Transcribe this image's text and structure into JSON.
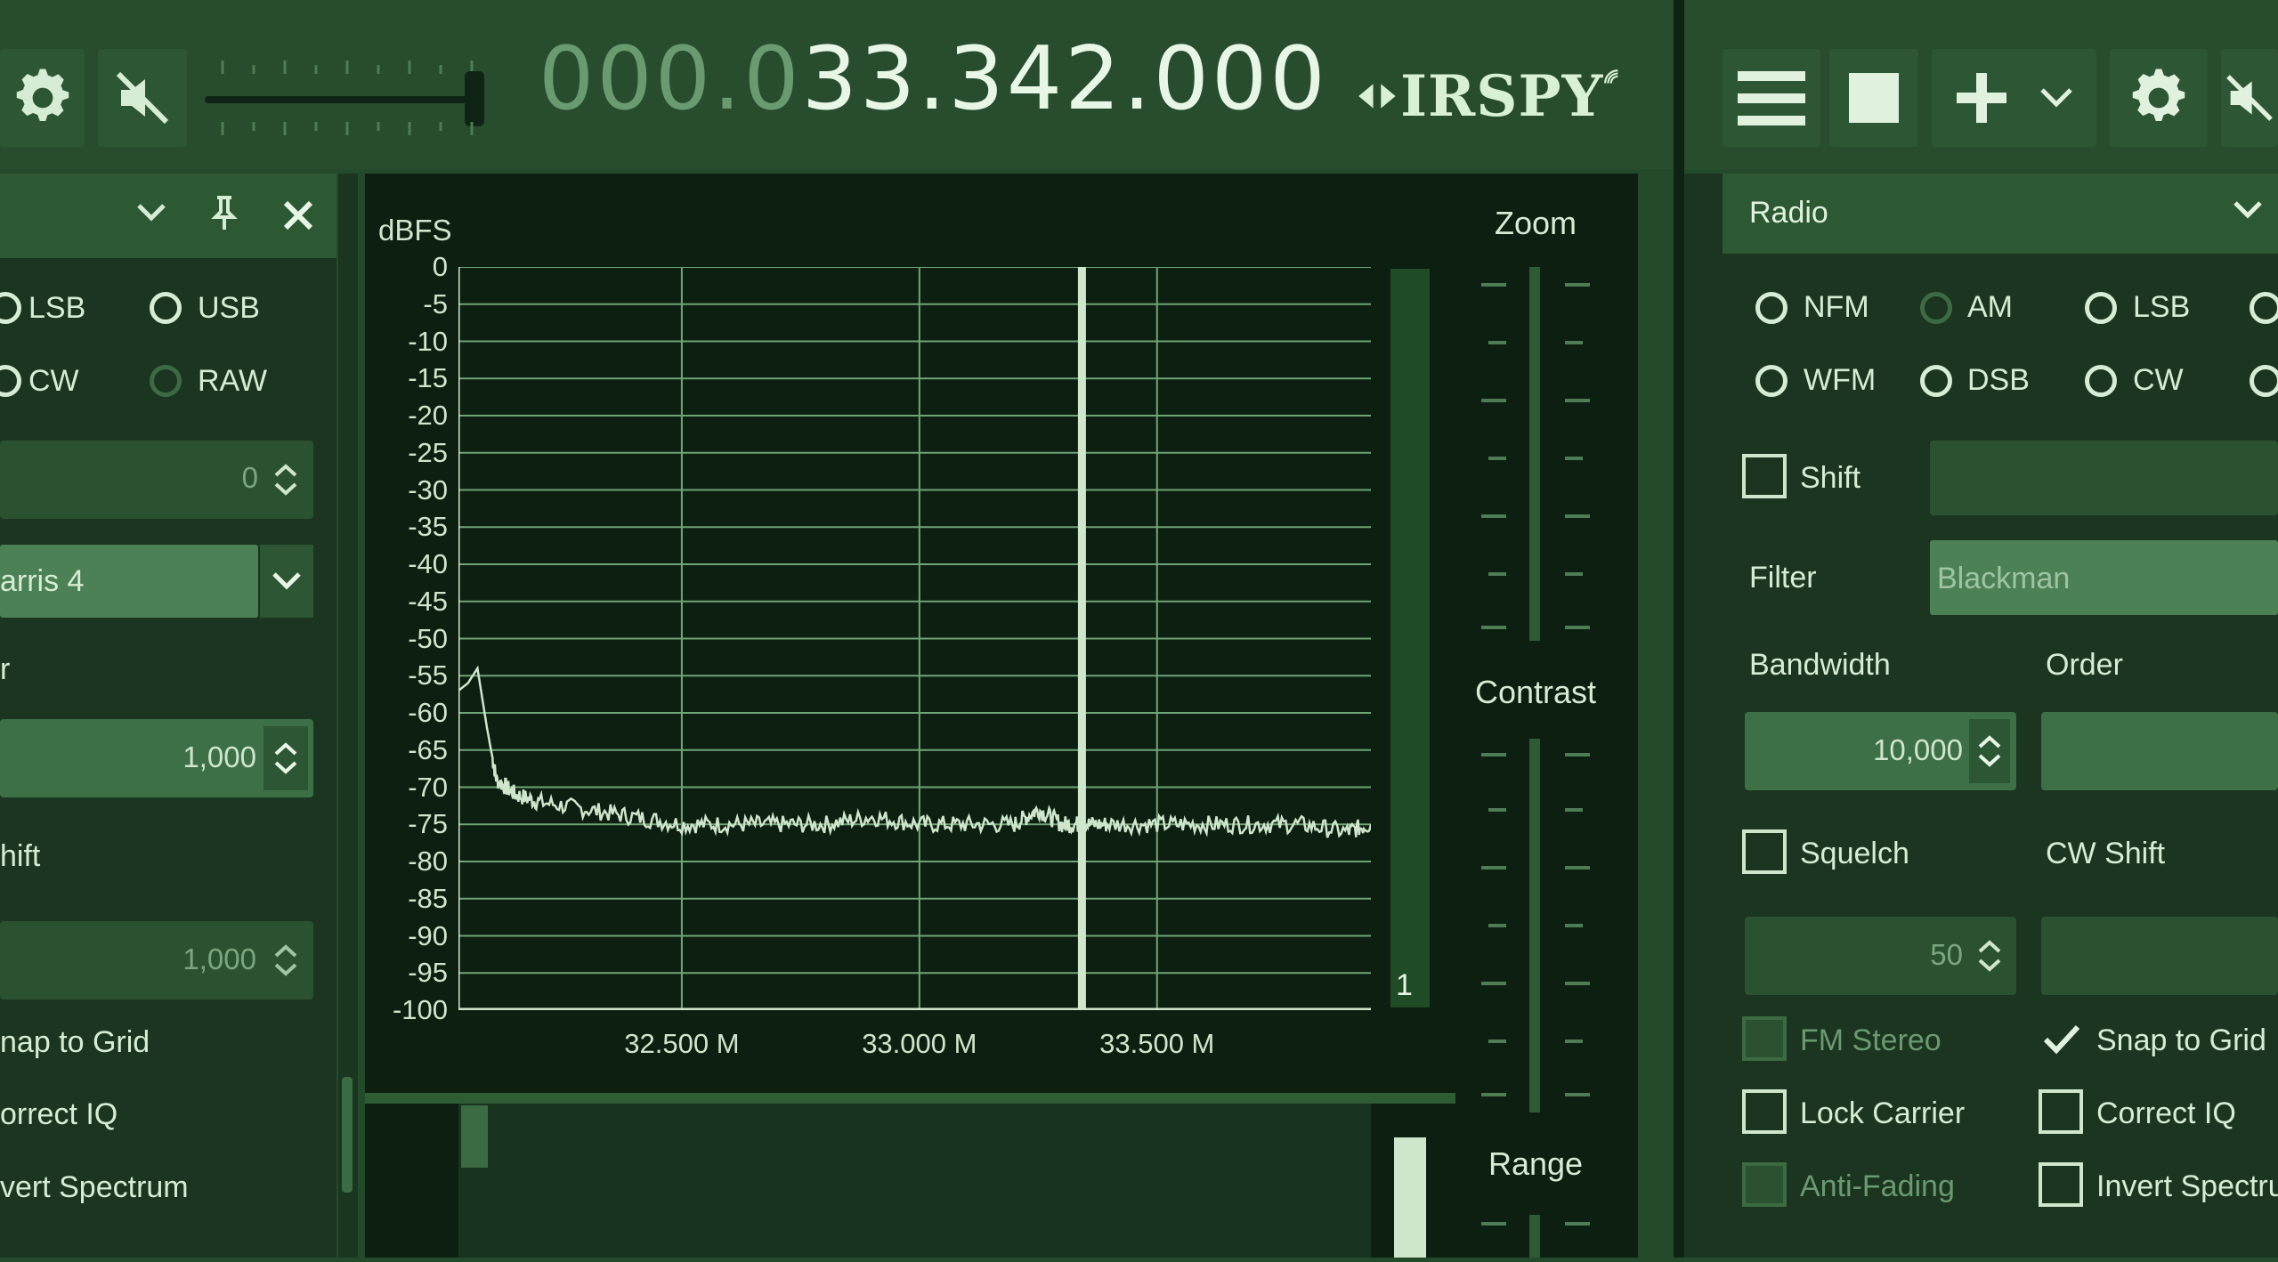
{
  "toolbar": {
    "frequency_dim": "000.0",
    "frequency_lit": "33.342.000",
    "logo_text": "IRSPY"
  },
  "left_panel": {
    "modes": [
      "LSB",
      "USB",
      "CW",
      "RAW"
    ],
    "spin_offset": "0",
    "window": "arris 4",
    "label_filter": "r",
    "spin_bandwidth": "1,000",
    "label_shift": "hift",
    "spin_shift": "1,000",
    "checks": [
      "nap to Grid",
      "orrect IQ",
      "vert Spectrum"
    ]
  },
  "fft": {
    "y_unit": "dBFS",
    "y_ticks": [
      "0",
      "-5",
      "-10",
      "-15",
      "-20",
      "-25",
      "-30",
      "-35",
      "-40",
      "-45",
      "-50",
      "-55",
      "-60",
      "-65",
      "-70",
      "-75",
      "-80",
      "-85",
      "-90",
      "-95",
      "-100"
    ],
    "x_ticks": [
      "32.500 M",
      "33.000 M",
      "33.500 M"
    ],
    "bar_number": "1",
    "zoom_label": "Zoom",
    "contrast_label": "Contrast",
    "range_label": "Range"
  },
  "chart_data": {
    "type": "line",
    "title": "",
    "xlabel": "",
    "ylabel": "dBFS",
    "ylim": [
      -100,
      0
    ],
    "xlim": [
      32.03,
      33.95
    ],
    "x_unit": "M",
    "series": [
      {
        "values_x": [
          32.03,
          32.05,
          32.07,
          32.09,
          32.11,
          32.15,
          32.2,
          32.3,
          32.4,
          32.5,
          32.6,
          32.7,
          32.8,
          32.9,
          33.0,
          33.1,
          33.2,
          33.25,
          33.3,
          33.342,
          33.4,
          33.5,
          33.6,
          33.7,
          33.8,
          33.9,
          33.95
        ],
        "values_y": [
          -57,
          -56,
          -54,
          -62,
          -69,
          -71,
          -72,
          -73,
          -74,
          -75,
          -75,
          -75,
          -75,
          -74,
          -75,
          -75,
          -75,
          -73,
          -75,
          -75,
          -75,
          -75,
          -75,
          -75,
          -75,
          -76,
          -75
        ]
      }
    ],
    "marker_x": 33.342
  },
  "right_panel": {
    "title": "Radio",
    "modes": [
      "NFM",
      "AM",
      "LSB",
      "WFM",
      "DSB",
      "CW"
    ],
    "shift_label": "Shift",
    "filter_label": "Filter",
    "filter_value": "Blackman",
    "bandwidth_label": "Bandwidth",
    "order_label": "Order",
    "bandwidth_value": "10,000",
    "squelch_label": "Squelch",
    "cwshift_label": "CW Shift",
    "squelch_value": "50",
    "fm_stereo": "FM Stereo",
    "snap_grid": "Snap to Grid",
    "lock_carrier": "Lock Carrier",
    "correct_iq": "Correct IQ",
    "anti_fading": "Anti-Fading",
    "invert_spectrum": "Invert Spectru"
  }
}
